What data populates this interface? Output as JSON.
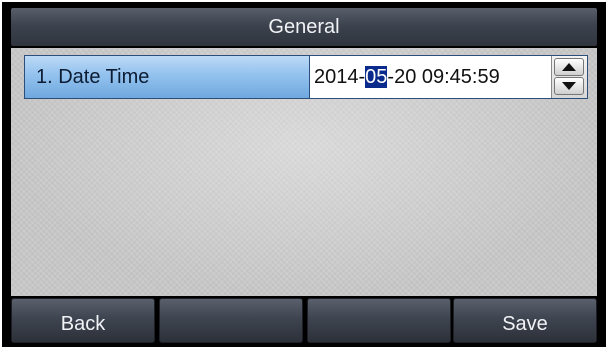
{
  "header": {
    "title": "General"
  },
  "settings": {
    "items": [
      {
        "label": "1. Date Time",
        "value_before": "2014-",
        "value_selected": "05",
        "value_after": "-20 09:45:59"
      }
    ]
  },
  "softkeys": [
    {
      "label": "Back"
    },
    {
      "label": ""
    },
    {
      "label": ""
    },
    {
      "label": "Save"
    }
  ],
  "icons": {
    "spin_up": "triangle-up-icon",
    "spin_down": "triangle-down-icon"
  },
  "colors": {
    "highlight": "#93c2ee",
    "selection": "#0a2a8c",
    "title_bar": "#3d434e"
  }
}
